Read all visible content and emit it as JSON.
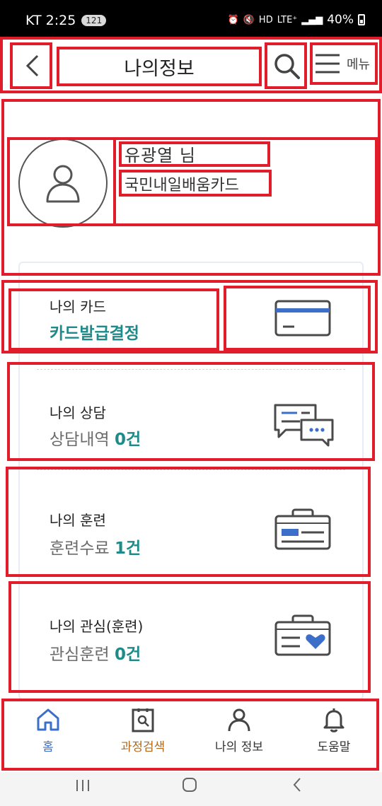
{
  "status": {
    "carrier_time": "KT 2:25",
    "notif_count": "121",
    "network": "LTE⁺",
    "battery": "40%"
  },
  "header": {
    "title": "나의정보",
    "menu_label": "메뉴"
  },
  "profile": {
    "name": "유광열 님",
    "card_type": "국민내일배움카드"
  },
  "items": {
    "card": {
      "title": "나의 카드",
      "status": "카드발급결정"
    },
    "counsel": {
      "title": "나의 상담",
      "sub_label": "상담내역",
      "count": "0건"
    },
    "training": {
      "title": "나의 훈련",
      "sub_label": "훈련수료",
      "count": "1건"
    },
    "interest": {
      "title": "나의 관심(훈련)",
      "sub_label": "관심훈련",
      "count": "0건"
    }
  },
  "bottom_nav": {
    "home": "홈",
    "course_search": "과정검색",
    "my_info": "나의 정보",
    "help": "도움말"
  },
  "colors": {
    "accent_teal": "#1f8a8a",
    "home_blue": "#3b6fc9",
    "course_orange": "#b06a1e",
    "highlight_red": "#e11d2b",
    "icon_blue": "#3b6fc9"
  },
  "icons": [
    "back-icon",
    "search-icon",
    "hamburger-icon",
    "user-icon",
    "credit-card-icon",
    "chat-bubbles-icon",
    "id-badge-icon",
    "badge-heart-icon",
    "home-icon",
    "document-search-icon",
    "person-icon",
    "bell-icon"
  ]
}
